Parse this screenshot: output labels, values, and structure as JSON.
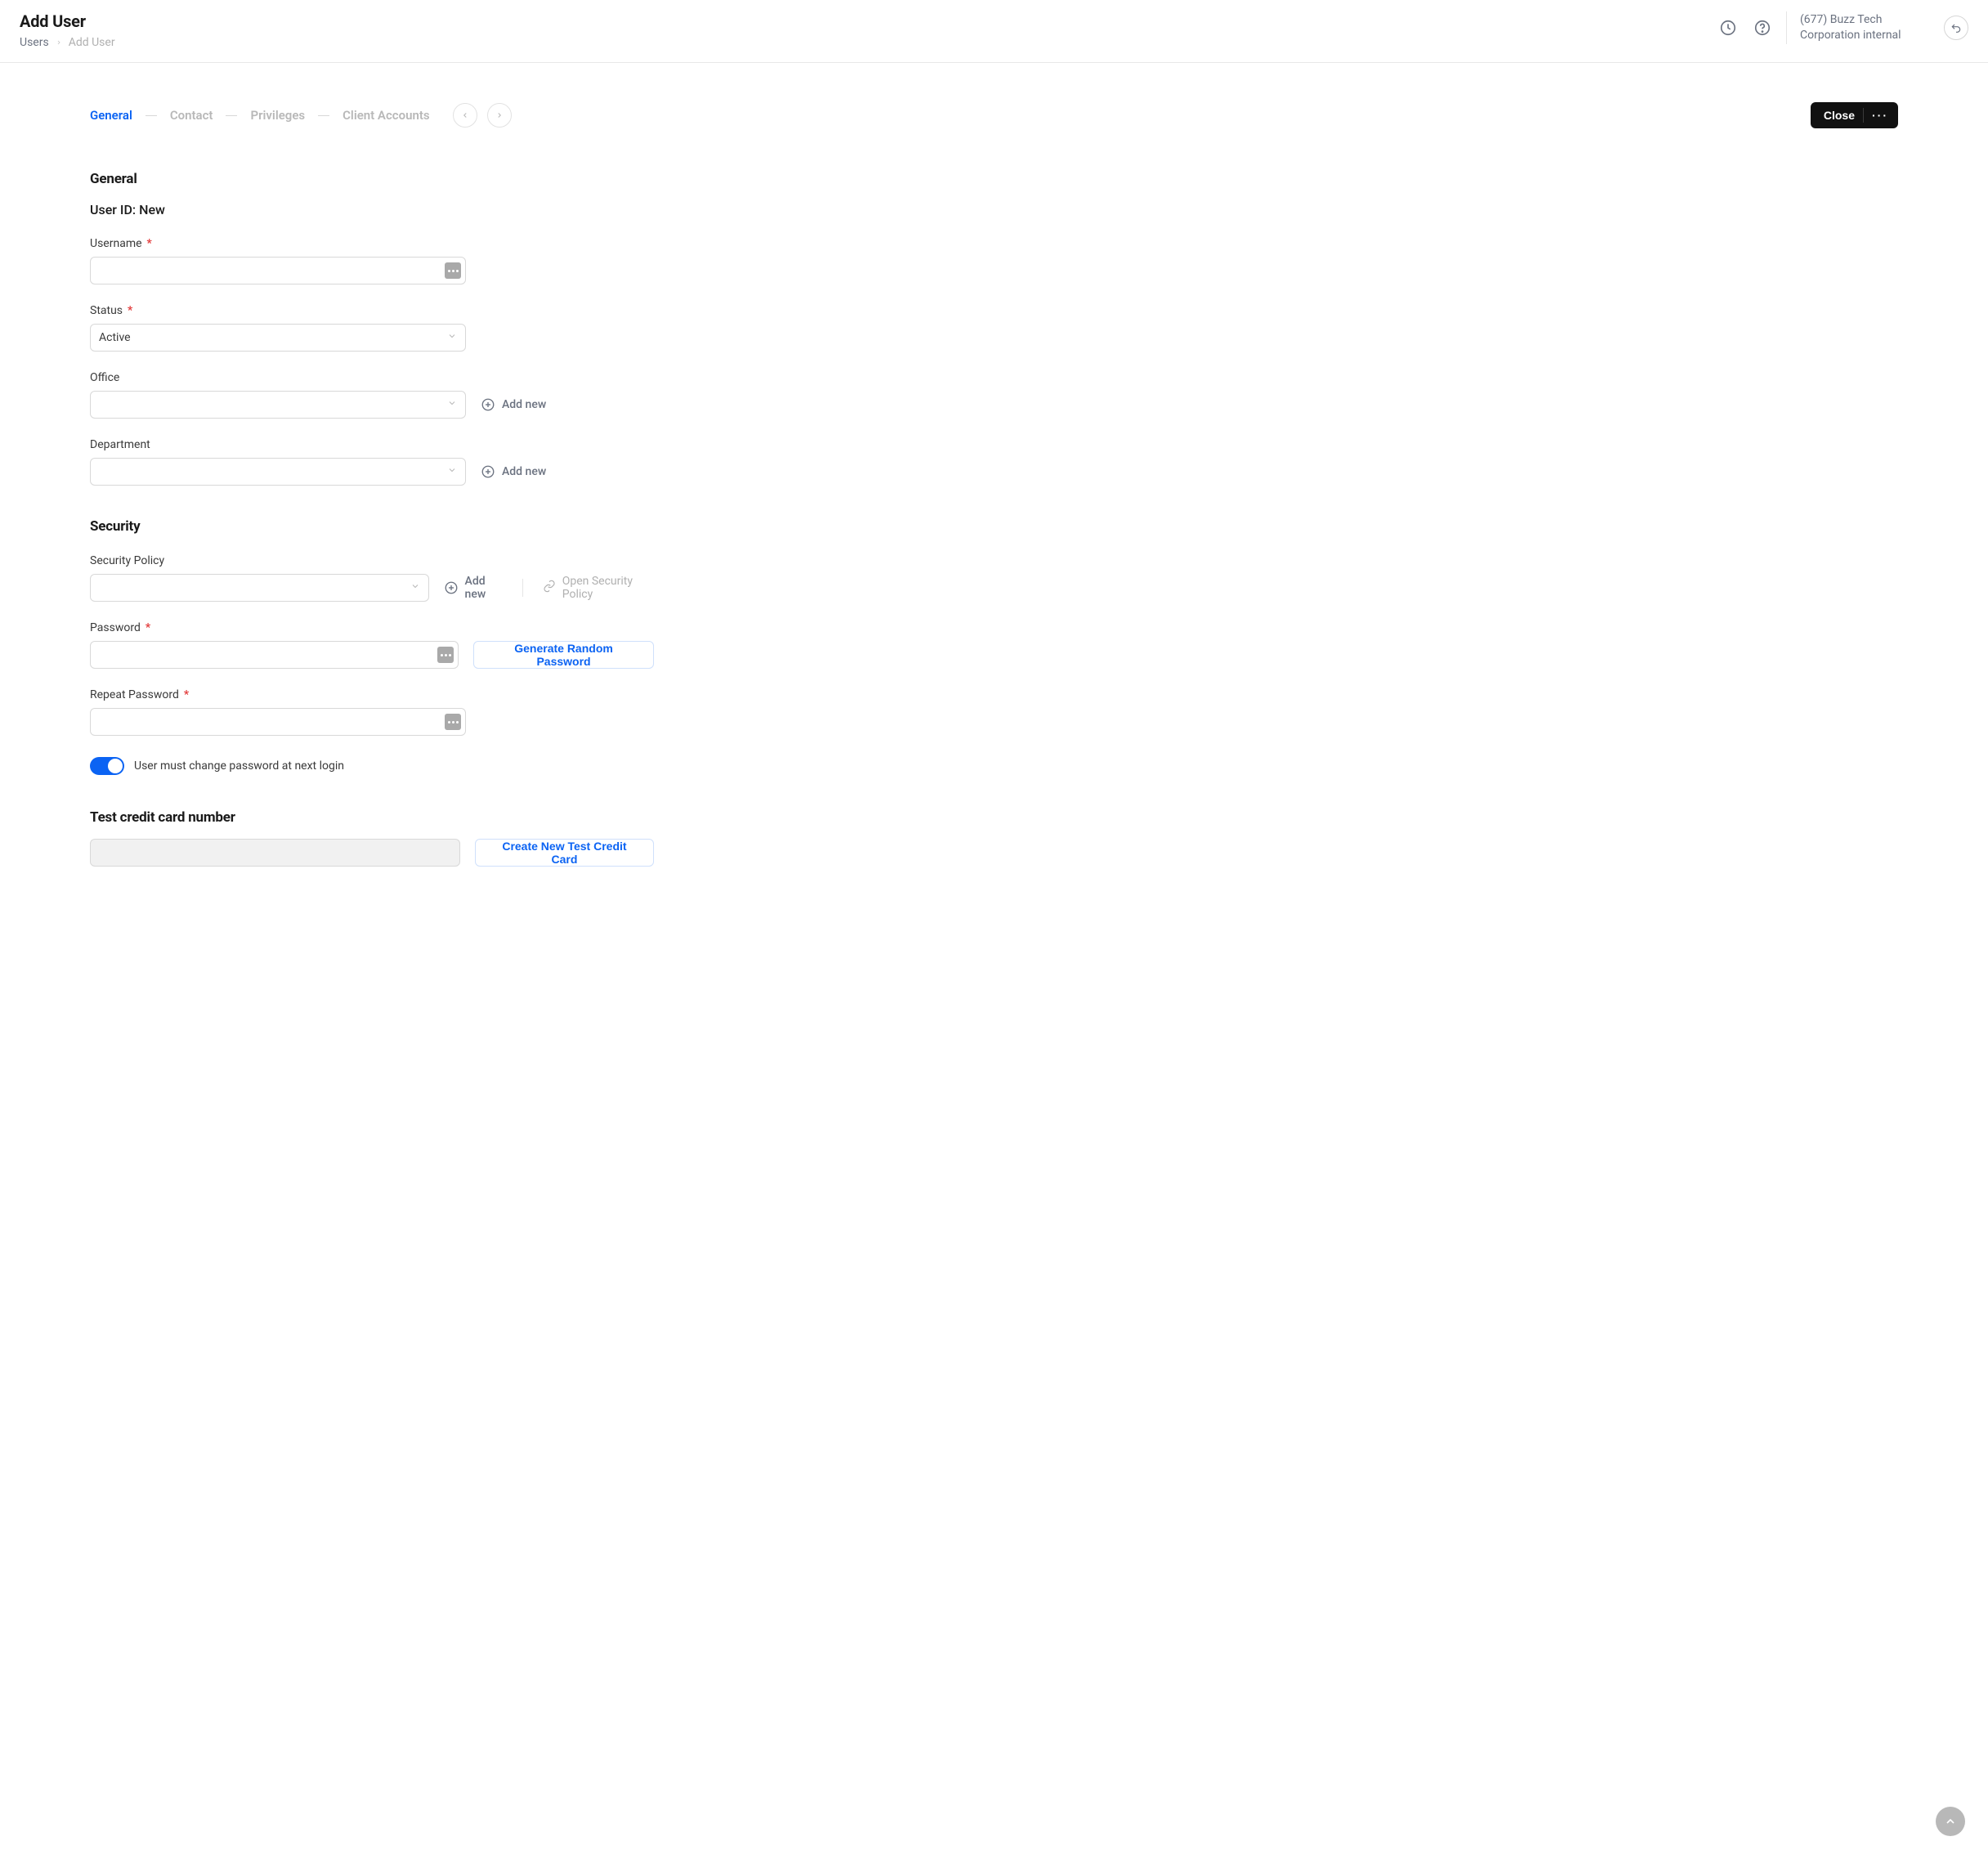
{
  "header": {
    "title": "Add User",
    "breadcrumb": {
      "root": "Users",
      "current": "Add User"
    },
    "company": "(677) Buzz Tech Corporation internal"
  },
  "tabs": {
    "items": [
      "General",
      "Contact",
      "Privileges",
      "Client Accounts"
    ],
    "active_index": 0,
    "close_label": "Close"
  },
  "sections": {
    "general": {
      "title": "General",
      "user_id_prefix": "User ID:",
      "user_id_value": "New",
      "fields": {
        "username": {
          "label": "Username",
          "required": true,
          "value": ""
        },
        "status": {
          "label": "Status",
          "required": true,
          "value": "Active"
        },
        "office": {
          "label": "Office",
          "value": "",
          "add_new": "Add new"
        },
        "department": {
          "label": "Department",
          "value": "",
          "add_new": "Add new"
        }
      }
    },
    "security": {
      "title": "Security",
      "fields": {
        "policy": {
          "label": "Security Policy",
          "value": "",
          "add_new": "Add new",
          "open_label": "Open Security Policy"
        },
        "password": {
          "label": "Password",
          "required": true,
          "value": "",
          "generate_label": "Generate Random Password"
        },
        "repeat": {
          "label": "Repeat Password",
          "required": true,
          "value": ""
        },
        "must_change": {
          "label": "User must change password at next login",
          "value": true
        }
      }
    },
    "testcc": {
      "title": "Test credit card number",
      "value": "",
      "create_label": "Create New Test Credit Card"
    }
  }
}
